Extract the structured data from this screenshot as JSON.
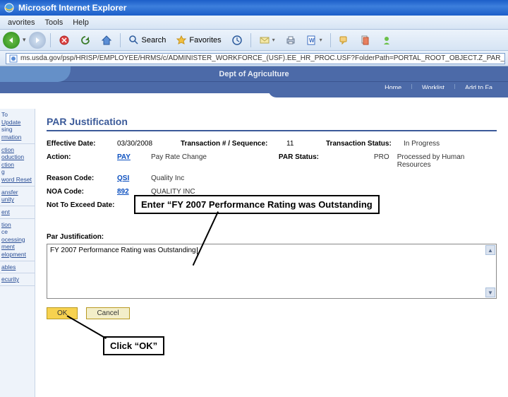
{
  "window": {
    "title": "Microsoft Internet Explorer",
    "menubar": [
      "avorites",
      "Tools",
      "Help"
    ],
    "toolbar": {
      "search": "Search",
      "favorites": "Favorites"
    },
    "address": "ms.usda.gov/psp/HRISP/EMPLOYEE/HRMS/c/ADMINISTER_WORKFORCE_(USF).EE_HR_PROC.USF?FolderPath=PORTAL_ROOT_OBJECT.Z_PAR_PROCESSING.HC_EE_HR_PROC_USF&IsFolder=false"
  },
  "app": {
    "header_title": "Dept of Agriculture",
    "nav": {
      "home": "Home",
      "worklist": "Worklist",
      "addfav": "Add to Fa"
    }
  },
  "sidebar": {
    "items": [
      [
        "To",
        "Update",
        "sing",
        "rmation"
      ],
      [
        "ction",
        "oduction",
        "ction",
        "g",
        "word Reset"
      ],
      [
        "ansfer",
        "unity"
      ],
      [
        "ent"
      ],
      [
        "tion",
        "ce",
        "ocessing",
        "ment",
        "elopment"
      ],
      [
        "ables"
      ],
      [
        "ecurity"
      ]
    ]
  },
  "page": {
    "title": "PAR Justification",
    "eff_date_lbl": "Effective Date:",
    "eff_date_val": "03/30/2008",
    "txn_lbl": "Transaction # / Sequence:",
    "txn_val": "11",
    "txn_status_lbl": "Transaction Status:",
    "txn_status_val": "In Progress",
    "action_lbl": "Action:",
    "action_code": "PAY",
    "action_desc": "Pay Rate Change",
    "par_status_lbl": "PAR Status:",
    "par_status_code": "PRO",
    "par_status_desc": "Processed by Human Resources",
    "reason_lbl": "Reason Code:",
    "reason_code": "QSI",
    "reason_desc": "Quality Inc",
    "noa_lbl": "NOA Code:",
    "noa_code": "892",
    "noa_desc": "QUALITY INC",
    "nte_lbl": "Not To Exceed Date:",
    "par_just_lbl": "Par Justification:",
    "par_just_val": "FY 2007 Performance Rating was Outstanding",
    "ok": "OK",
    "cancel": "Cancel"
  },
  "callouts": {
    "enter": "Enter “FY 2007 Performance Rating was Outstanding",
    "click_ok": "Click “OK”"
  }
}
